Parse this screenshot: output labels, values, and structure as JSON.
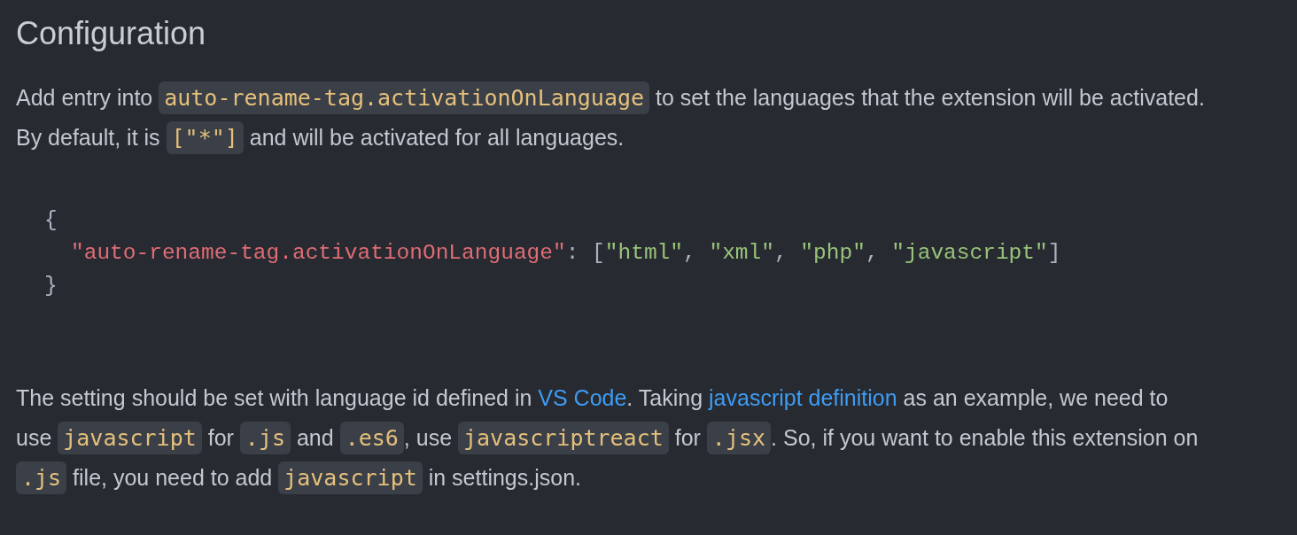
{
  "heading": "Configuration",
  "intro": [
    {
      "kind": "text",
      "text": "Add entry into "
    },
    {
      "kind": "code",
      "text": "auto-rename-tag.activationOnLanguage"
    },
    {
      "kind": "text",
      "text": " to set the languages that the extension will be activated. By default, it is "
    },
    {
      "kind": "code",
      "text": "[\"*\"]"
    },
    {
      "kind": "text",
      "text": " and will be activated for all languages."
    }
  ],
  "code_block": [
    {
      "indented": false,
      "tokens": [
        {
          "kind": "punct",
          "text": "{"
        }
      ]
    },
    {
      "indented": true,
      "tokens": [
        {
          "kind": "key",
          "text": "\"auto-rename-tag.activationOnLanguage\""
        },
        {
          "kind": "punct",
          "text": ": ["
        },
        {
          "kind": "string",
          "text": "\"html\""
        },
        {
          "kind": "punct",
          "text": ", "
        },
        {
          "kind": "string",
          "text": "\"xml\""
        },
        {
          "kind": "punct",
          "text": ", "
        },
        {
          "kind": "string",
          "text": "\"php\""
        },
        {
          "kind": "punct",
          "text": ", "
        },
        {
          "kind": "string",
          "text": "\"javascript\""
        },
        {
          "kind": "punct",
          "text": "]"
        }
      ]
    },
    {
      "indented": false,
      "tokens": [
        {
          "kind": "punct",
          "text": "}"
        }
      ]
    }
  ],
  "note": [
    {
      "kind": "text",
      "text": "The setting should be set with language id defined in "
    },
    {
      "kind": "link",
      "text": "VS Code"
    },
    {
      "kind": "text",
      "text": ". Taking "
    },
    {
      "kind": "link",
      "text": "javascript definition"
    },
    {
      "kind": "text",
      "text": " as an example, we need to use "
    },
    {
      "kind": "code",
      "text": "javascript"
    },
    {
      "kind": "text",
      "text": " for "
    },
    {
      "kind": "code",
      "text": ".js"
    },
    {
      "kind": "text",
      "text": " and "
    },
    {
      "kind": "code",
      "text": ".es6"
    },
    {
      "kind": "text",
      "text": ", use "
    },
    {
      "kind": "code",
      "text": "javascriptreact"
    },
    {
      "kind": "text",
      "text": " for "
    },
    {
      "kind": "code",
      "text": ".jsx"
    },
    {
      "kind": "text",
      "text": ". So, if you want to enable this extension on "
    },
    {
      "kind": "code",
      "text": ".js"
    },
    {
      "kind": "text",
      "text": " file, you need to add "
    },
    {
      "kind": "code",
      "text": "javascript"
    },
    {
      "kind": "text",
      "text": " in settings.json."
    }
  ]
}
